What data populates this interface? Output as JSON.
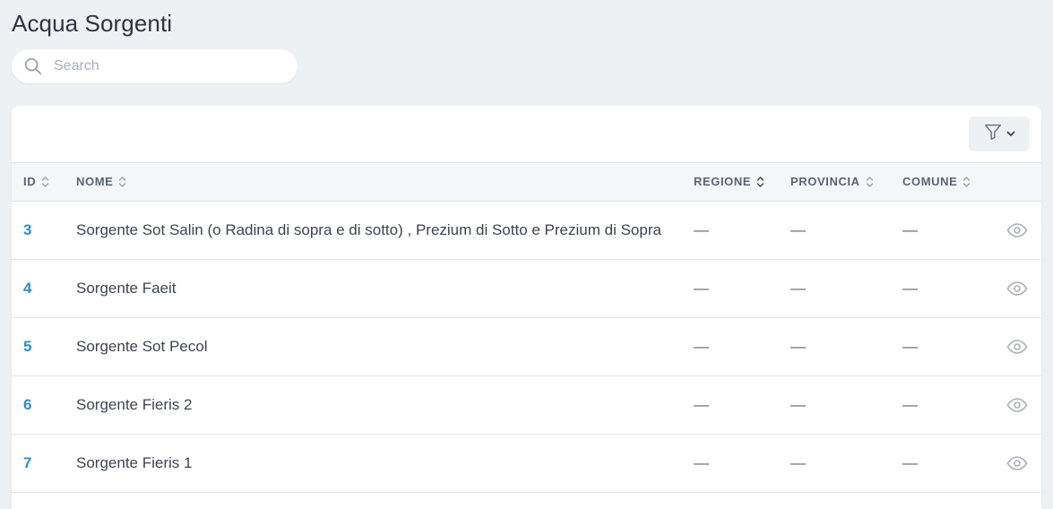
{
  "page": {
    "title": "Acqua Sorgenti"
  },
  "search": {
    "placeholder": "Search",
    "value": ""
  },
  "toolbar": {
    "filter_icon": "filter-icon",
    "chevron_icon": "chevron-down-icon"
  },
  "table": {
    "columns": [
      {
        "key": "id",
        "label": "ID"
      },
      {
        "key": "nome",
        "label": "NOME"
      },
      {
        "key": "regione",
        "label": "REGIONE"
      },
      {
        "key": "provincia",
        "label": "PROVINCIA"
      },
      {
        "key": "comune",
        "label": "COMUNE"
      }
    ],
    "rows": [
      {
        "id": "3",
        "nome": "Sorgente Sot Salin (o Radina di sopra e di sotto) , Prezium di Sotto e Prezium di Sopra",
        "regione": "—",
        "provincia": "—",
        "comune": "—"
      },
      {
        "id": "4",
        "nome": "Sorgente Faeit",
        "regione": "—",
        "provincia": "—",
        "comune": "—"
      },
      {
        "id": "5",
        "nome": "Sorgente Sot Pecol",
        "regione": "—",
        "provincia": "—",
        "comune": "—"
      },
      {
        "id": "6",
        "nome": "Sorgente Fieris 2",
        "regione": "—",
        "provincia": "—",
        "comune": "—"
      },
      {
        "id": "7",
        "nome": "Sorgente Fieris 1",
        "regione": "—",
        "provincia": "—",
        "comune": "—"
      }
    ]
  },
  "colors": {
    "accent": "#2a8fc8",
    "background": "#eef1f4",
    "header_bg": "#f4f6f8"
  }
}
